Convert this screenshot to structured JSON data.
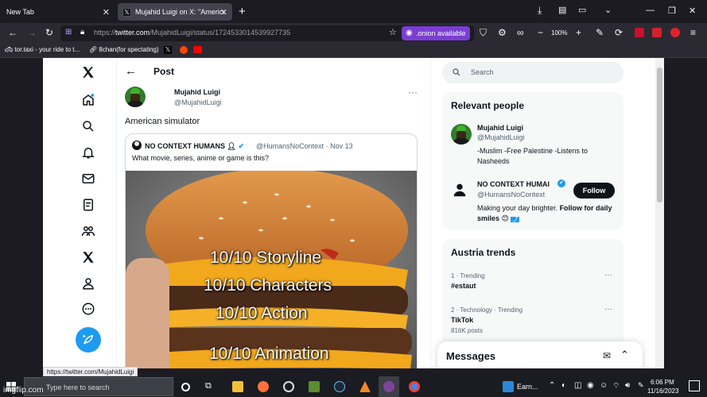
{
  "browser": {
    "tabs": [
      {
        "label": "New Tab"
      },
      {
        "label": "Mujahid Luigi on X: \"American"
      }
    ],
    "url_prefix": "https://",
    "url_host": "twitter.com",
    "url_path": "/MujahidLuigi/status/1724533014539927735",
    "onion_badge": ".onion available",
    "zoom": "100%",
    "bookmarks": [
      {
        "label": "tor.taxi - your ride to t..."
      },
      {
        "label": "8chan(for spectating)"
      }
    ],
    "status_link": "https://twitter.com/MujahidLuigi"
  },
  "post": {
    "header_title": "Post",
    "author_name": "Mujahid Luigi",
    "author_handle": "@MujahidLuigi",
    "text": "American simulator",
    "quote": {
      "name": "NO CONTEXT HUMANS",
      "handle_date": "@HumansNoContext · Nov 13",
      "text": "What movie, series, anime or game is this?",
      "image_lines": [
        "10/10 Storyline",
        "10/10 Characters",
        "10/10 Action",
        "10/10 Animation"
      ]
    }
  },
  "sidebar": {
    "search_placeholder": "Search",
    "relevant_title": "Relevant people",
    "people": [
      {
        "name": "Mujahid Luigi",
        "handle": "@MujahidLuigi",
        "bio": "-Muslim -Free Palestine -Listens to Nasheeds"
      },
      {
        "name": "NO CONTEXT HUMAI",
        "handle": "@HumansNoContext",
        "bio_start": "Making your day brighter. ",
        "bio_bold": "Follow for daily smiles",
        "follow_label": "Follow"
      }
    ],
    "trends_title": "Austria trends",
    "trends": [
      {
        "meta": "1 · Trending",
        "name": "#estaut",
        "count": ""
      },
      {
        "meta": "2 · Technology · Trending",
        "name": "TikTok",
        "count": "816K posts"
      }
    ],
    "messages_title": "Messages"
  },
  "taskbar": {
    "search_placeholder": "Type here to search",
    "news_label": "Earn...",
    "time": "6:06 PM",
    "date": "11/16/2023"
  },
  "watermark": "imgflip.com",
  "colors": {
    "x_blue": "#1d9bf0",
    "onion_purple": "#7a3ed1",
    "text_primary": "#0f1419",
    "text_secondary": "#536471"
  }
}
